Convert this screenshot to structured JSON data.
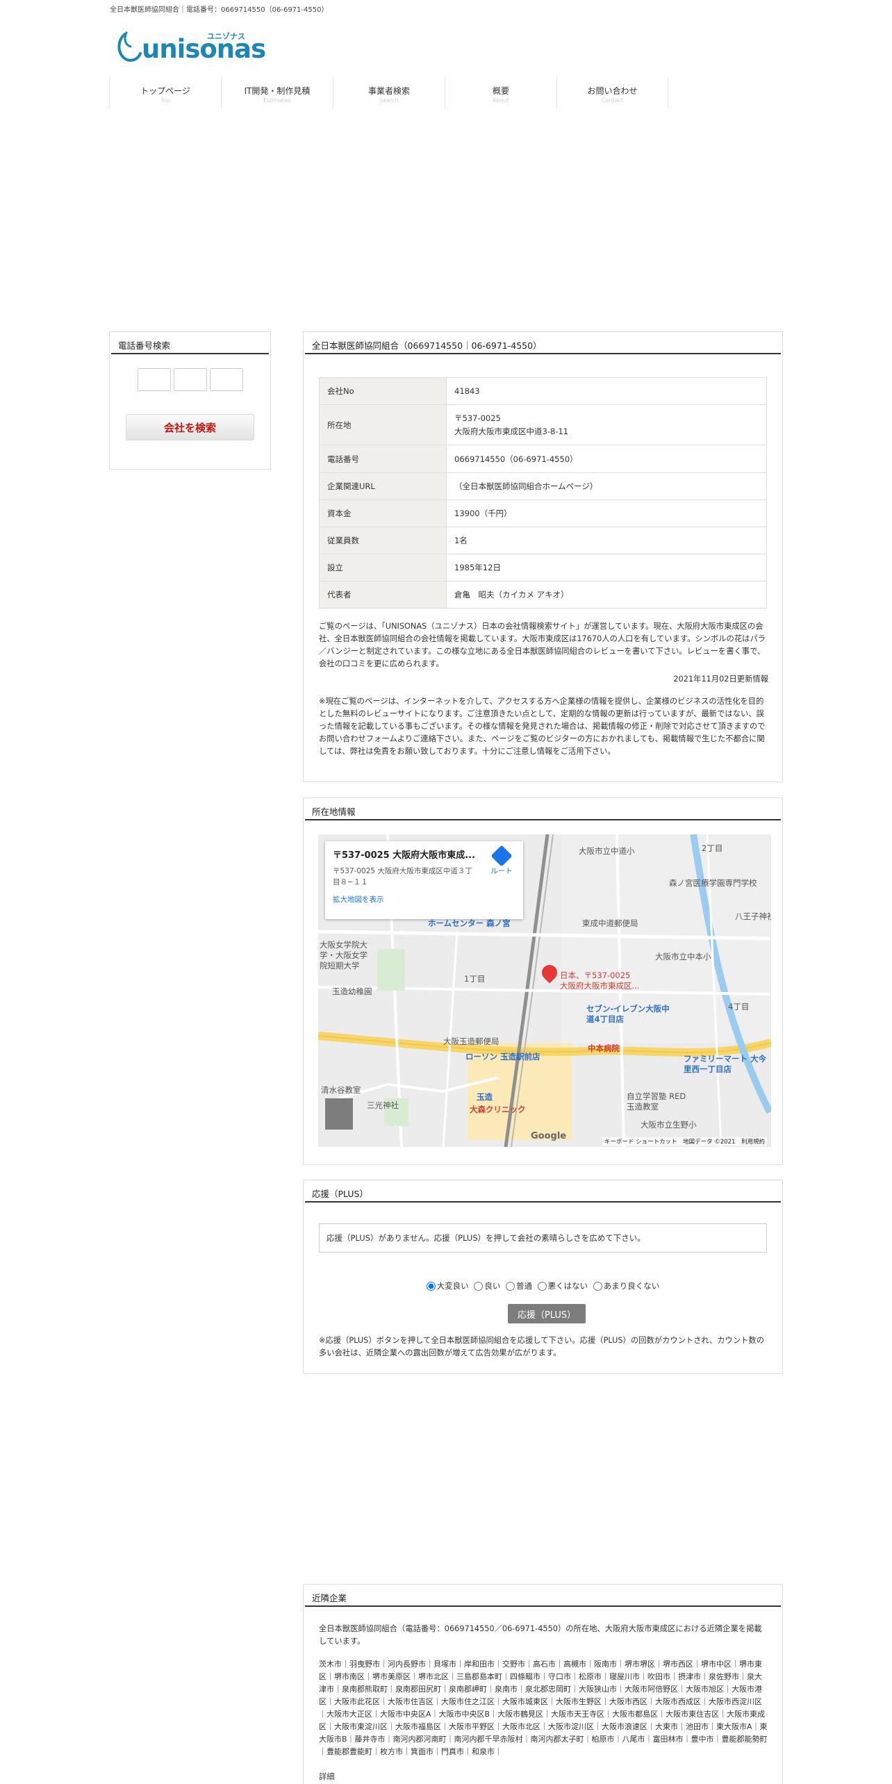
{
  "header": {
    "topbar_text": "全日本獣医師協同組合｜電話番号：0669714550（06-6971-4550）",
    "logo_text": "unisonas",
    "logo_kana": "ユニゾナス"
  },
  "nav": [
    {
      "label": "トップページ",
      "sub": "Top"
    },
    {
      "label": "IT開発・制作見積",
      "sub": "Estimates"
    },
    {
      "label": "事業者検索",
      "sub": "Search"
    },
    {
      "label": "概要",
      "sub": "About"
    },
    {
      "label": "お問い合わせ",
      "sub": "Contact"
    }
  ],
  "sidebar": {
    "title": "電話番号検索",
    "search_button": "会社を検索"
  },
  "company": {
    "title": "全日本獣医師協同組合（0669714550｜06-6971-4550）",
    "rows": [
      {
        "key": "会社No",
        "value": "41843"
      },
      {
        "key": "所在地",
        "value": "〒537-0025",
        "value2": "大阪府大阪市東成区中道3-8-11"
      },
      {
        "key": "電話番号",
        "value": "0669714550（06-6971-4550）"
      },
      {
        "key": "企業関連URL",
        "value": "（全日本獣医師協同組合ホームページ）"
      },
      {
        "key": "資本金",
        "value": "13900（千円）"
      },
      {
        "key": "従業員数",
        "value": "1名"
      },
      {
        "key": "設立",
        "value": "1985年12日"
      },
      {
        "key": "代表者",
        "value": "倉亀　昭夫（カイカメ アキオ）"
      }
    ],
    "description": "ご覧のページは、「UNISONAS（ユニゾナス）日本の会社情報検索サイト」が運営しています。現在、大阪府大阪市東成区の会社、全日本獣医師協同組合の会社情報を掲載しています。大阪市東成区は17670人の人口を有しています。シンボルの花はパラ／バンジーと制定されています。この様な立地にある全日本獣医師協同組合のレビューを書いて下さい。レビューを書く事で、会社の口コミを更に広められます。",
    "updated": "2021年11月02日更新情報",
    "note": "※現在ご覧のページは、インターネットを介して、アクセスする方へ企業様の情報を提供し、企業様のビジネスの活性化を目的とした無料のレビューサイトになります。ご注意頂きたい点として、定期的な情報の更新は行っていますが、最新ではない、誤った情報を記載している事もございます。その様な情報を発見された場合は、掲載情報の修正・削除で対応させて頂きますのでお問い合わせフォームよりご連絡下さい。また、ページをご覧のビジターの方におかれましても、掲載情報で生じた不都合に関しては、弊社は免責をお願い致しております。十分にご注意し情報をご活用下さい。"
  },
  "location": {
    "title": "所在地情報",
    "card_title": "〒537-0025 大阪府大阪市東成...",
    "card_address": "〒537-0025 大阪府大阪市東成区中道３丁目８−１１",
    "card_link": "拡大地図を表示",
    "route_label": "ルート",
    "pin_label_1": "日本、〒537-0025",
    "pin_label_2": "大阪府大阪市東成区...",
    "footer": "キーボード ショートカット　地図データ ©2021　利用規約",
    "google": "Google",
    "places": [
      "大阪市立中道小",
      "森ノ宮医療学園専門学校",
      "ホームセンター 森ノ宮",
      "東成中道郵便局",
      "大阪女学院大学・大阪女学院短期大学",
      "セブン-イレブン大阪中道4丁目店",
      "中本病院",
      "大阪玉造郵便局",
      "ローソン 玉造駅前店",
      "ファミリーマート 大今里西一丁目店",
      "大森クリニック",
      "自立学習塾 RED 玉造教室",
      "大阪市立生野小",
      "清水谷教室",
      "三光神社",
      "玉造幼稚園",
      "大阪市立中本小",
      "八王子神社",
      "玉造",
      "1丁目",
      "4丁目",
      "2丁目"
    ]
  },
  "support": {
    "title": "応援（PLUS）",
    "empty_text": "応援（PLUS）がありません。応援（PLUS）を押して会社の素晴らしさを広めて下さい。",
    "options": [
      "大変良い",
      "良い",
      "普通",
      "悪くはない",
      "あまり良くない"
    ],
    "button": "応援（PLUS）",
    "note": "※応援（PLUS）ボタンを押して全日本獣医師協同組合を応援して下さい。応援（PLUS）の回数がカウントされ、カウント数の多い会社は、近隣企業への露出回数が増えて広告効果が広がります。"
  },
  "nearby": {
    "title": "近隣企業",
    "description": "全日本獣医師協同組合（電話番号：0669714550／06-6971-4550）の所在地、大阪府大阪市東成区における近隣企業を掲載しています。",
    "areas": "茨木市｜羽曳野市｜河内長野市｜貝塚市｜岸和田市｜交野市｜高石市｜高槻市｜阪南市｜堺市堺区｜堺市西区｜堺市中区｜堺市東区｜堺市南区｜堺市美原区｜堺市北区｜三島郡島本町｜四條畷市｜守口市｜松原市｜寝屋川市｜吹田市｜摂津市｜泉佐野市｜泉大津市｜泉南郡熊取町｜泉南郡田尻町｜泉南郡岬町｜泉南市｜泉北郡忠岡町｜大阪狭山市｜大阪市阿倍野区｜大阪市旭区｜大阪市港区｜大阪市此花区｜大阪市住吉区｜大阪市住之江区｜大阪市城東区｜大阪市生野区｜大阪市西区｜大阪市西成区｜大阪市西淀川区｜大阪市大正区｜大阪市中央区A｜大阪市中央区B｜大阪市鶴見区｜大阪市天王寺区｜大阪市都島区｜大阪市東住吉区｜大阪市東成区｜大阪市東淀川区｜大阪市福島区｜大阪市平野区｜大阪市北区｜大阪市淀川区｜大阪市浪速区｜大東市｜池田市｜東大阪市A｜東大阪市B｜藤井寺市｜南河内郡河南町｜南河内郡千早赤阪村｜南河内郡太子町｜柏原市｜八尾市｜富田林市｜豊中市｜豊能郡能勢町｜豊能郡豊能町｜枚方市｜箕面市｜門真市｜和泉市｜",
    "detail": "詳細"
  },
  "colors": {
    "brand": "#1e86b5",
    "search_text": "#c0170f",
    "pin": "#e53935"
  }
}
